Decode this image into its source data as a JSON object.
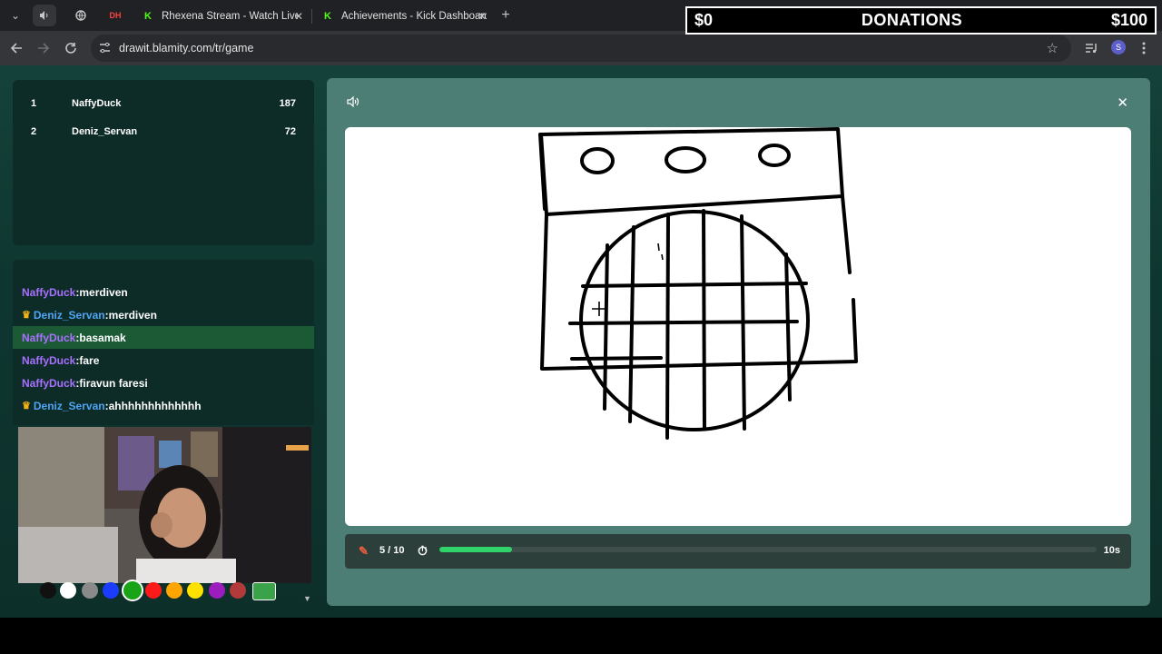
{
  "browser": {
    "tabs": [
      {
        "title": "Rhexena Stream - Watch Live o",
        "favicon": "kick-icon"
      },
      {
        "title": "Achievements - Kick Dashboard",
        "favicon": "kick-icon"
      }
    ],
    "pinned_tab_label": "DH",
    "new_tab": "+",
    "close_glyph": "✕",
    "url": "drawit.blamity.com/tr/game",
    "profile_initial": "S"
  },
  "overlay": {
    "left_amount": "$0",
    "title": "DONATIONS",
    "right_amount": "$100"
  },
  "leaderboard": [
    {
      "rank": "1",
      "name": "NaffyDuck",
      "score": "187"
    },
    {
      "rank": "2",
      "name": "Deniz_Servan",
      "score": "72"
    }
  ],
  "chat": [
    {
      "user": "NaffyDuck",
      "text": "merdiven",
      "crown": false,
      "highlight": false
    },
    {
      "user": "Deniz_Servan",
      "text": "merdiven",
      "crown": true,
      "highlight": false
    },
    {
      "user": "NaffyDuck",
      "text": "basamak",
      "crown": false,
      "highlight": true
    },
    {
      "user": "NaffyDuck",
      "text": "fare",
      "crown": false,
      "highlight": false
    },
    {
      "user": "NaffyDuck",
      "text": "firavun faresi",
      "crown": false,
      "highlight": false
    },
    {
      "user": "Deniz_Servan",
      "text": "ahhhhhhhhhhhhh",
      "crown": true,
      "highlight": false
    }
  ],
  "palette": {
    "colors": [
      "#111111",
      "#ffffff",
      "#8a8a8a",
      "#1a3cff",
      "#19a317",
      "#ff1a1a",
      "#ffa500",
      "#ffe100",
      "#9b1dbd",
      "#b33a3a",
      "#3aa34a"
    ],
    "selected_index": 4
  },
  "game": {
    "round": "5 / 10",
    "time_left": "10s",
    "progress_fraction": 0.11
  }
}
